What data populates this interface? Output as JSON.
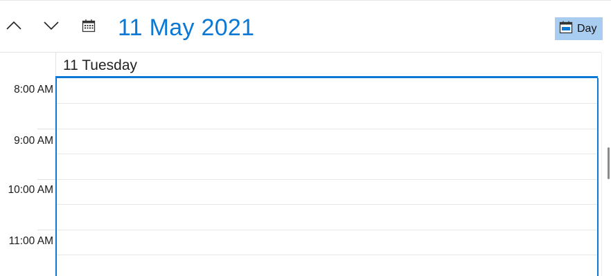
{
  "toolbar": {
    "title": "11 May 2021",
    "view_label": "Day",
    "icons": {
      "up": "chevron-up-icon",
      "down": "chevron-down-icon",
      "calendar": "calendar-icon",
      "view": "day-view-icon"
    }
  },
  "day_header": {
    "label": "11 Tuesday"
  },
  "time_slots": [
    {
      "label": "8:00 AM"
    },
    {
      "label": "9:00 AM"
    },
    {
      "label": "10:00 AM"
    },
    {
      "label": "11:00 AM"
    }
  ],
  "colors": {
    "accent": "#0a78d4",
    "view_button_bg": "#a9cdf0"
  }
}
